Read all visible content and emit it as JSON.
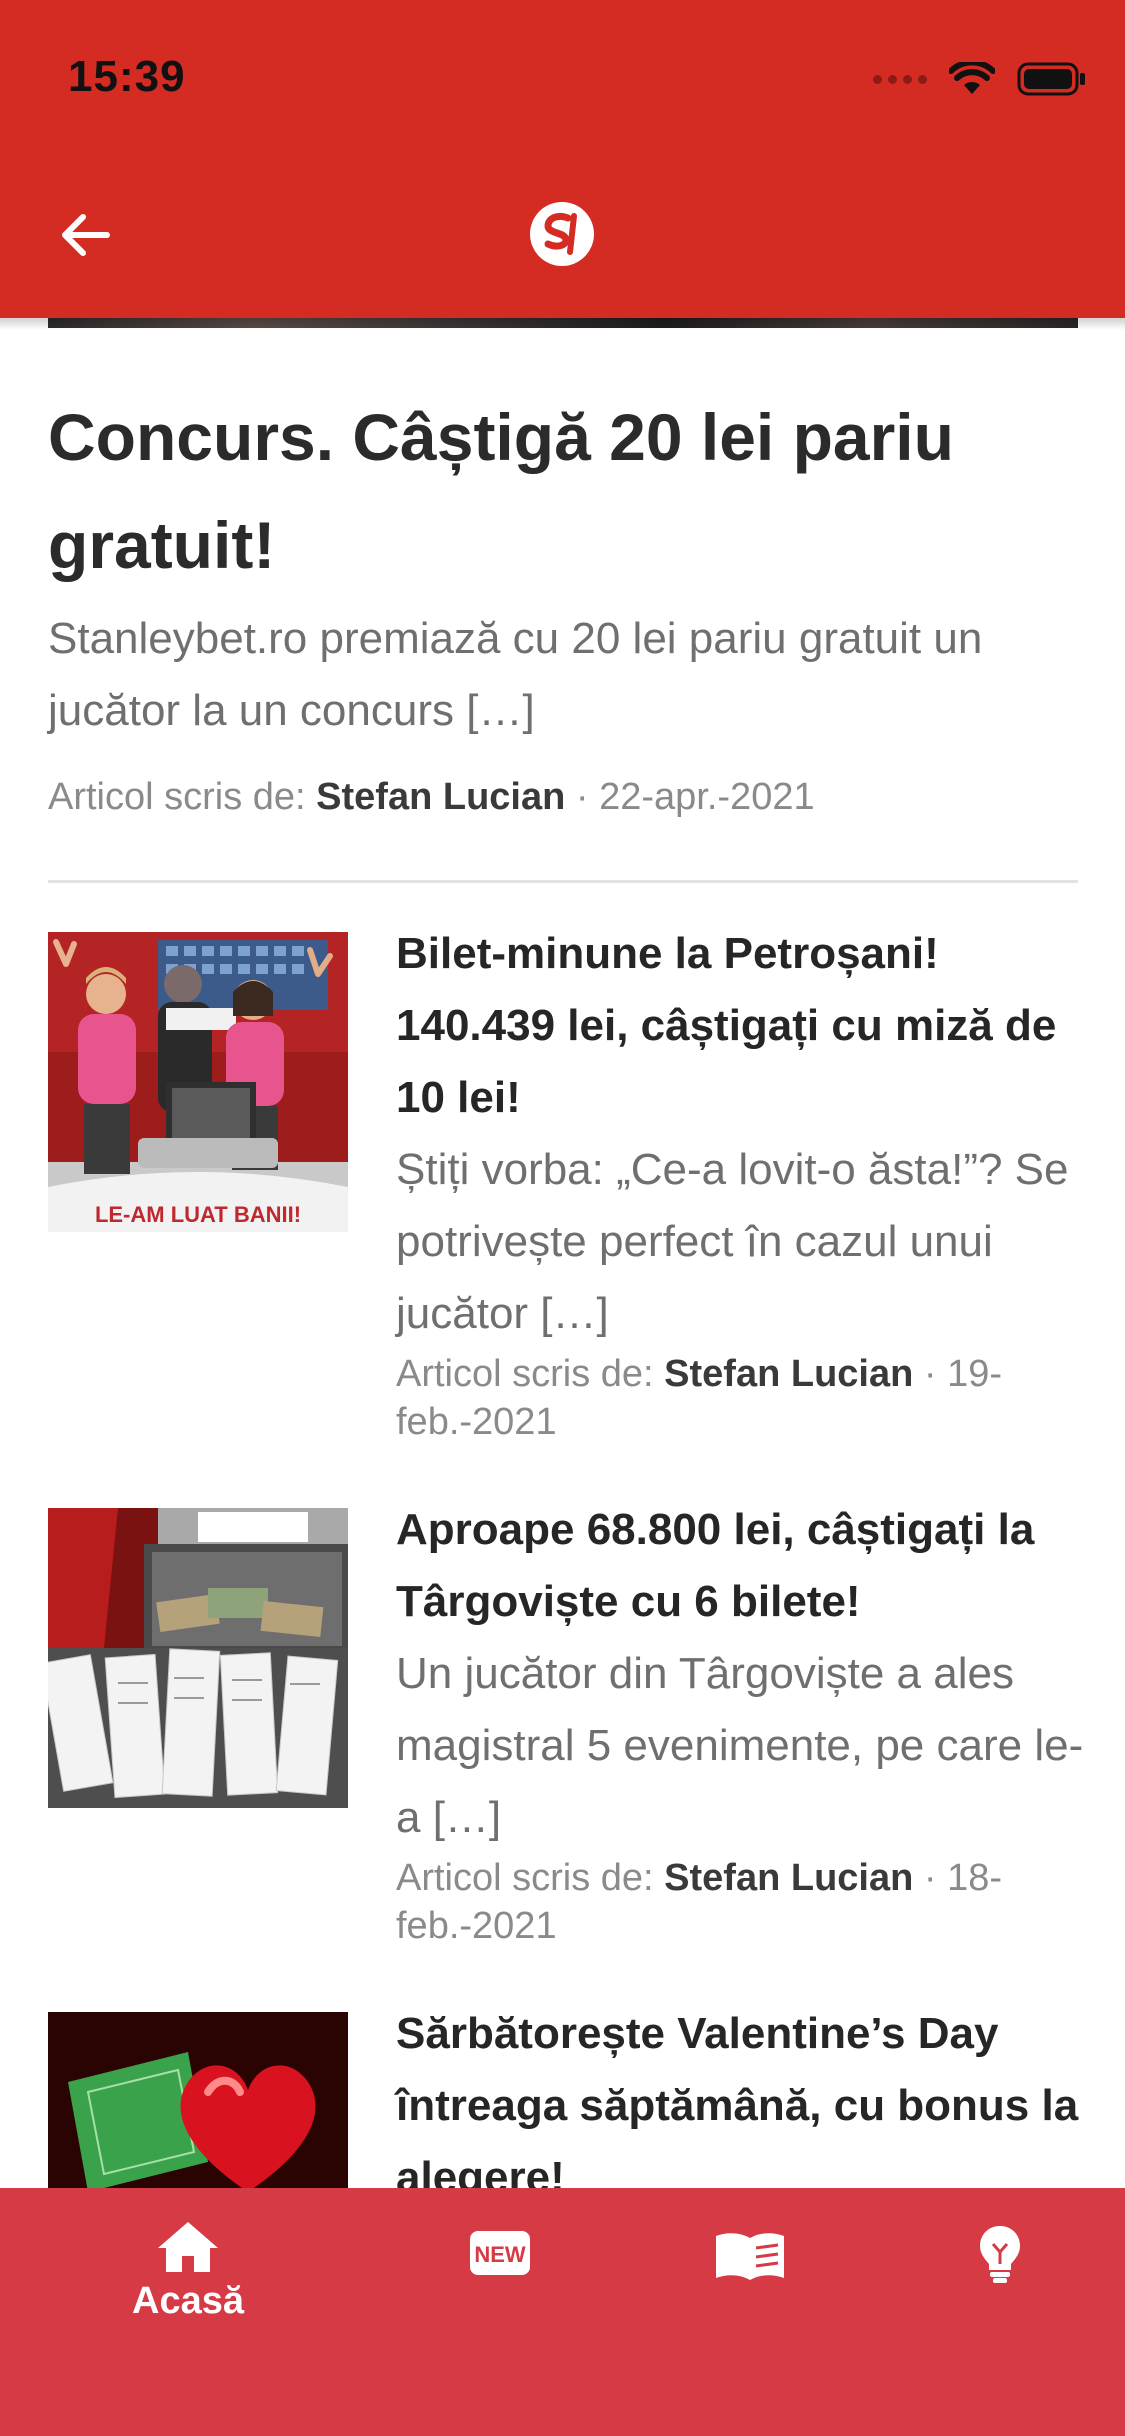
{
  "status_bar": {
    "time": "15:39"
  },
  "feature": {
    "title": "Concurs. Câștigă 20 lei pariu gratuit!",
    "excerpt": "Stanleybet.ro premiază cu 20 lei pariu gratuit un jucător la un concurs […]",
    "meta_prefix": "Articol scris de: ",
    "author": "Stefan Lucian",
    "date": " · 22-apr.-2021"
  },
  "articles": [
    {
      "title": "Bilet-minune la Petroșani! 140.439 lei, câștigați cu miză de 10 lei!",
      "excerpt": "Știți vorba: „Ce-a lovit-o ăsta!”? Se potrivește perfect în cazul unui jucător […]",
      "meta_prefix": "Articol scris de: ",
      "author": "Stefan Lucian",
      "date": " · 19-feb.-2021",
      "thumb_banner": "LE-AM LUAT BANII!"
    },
    {
      "title": "Aproape 68.800 lei, câștigați la Târgoviște cu 6 bilete!",
      "excerpt": "Un jucător din Târgoviște a ales magistral 5 evenimente, pe care le-a […]",
      "meta_prefix": "Articol scris de: ",
      "author": "Stefan Lucian",
      "date": " · 18-feb.-2021"
    },
    {
      "title": "Sărbătorește Valentine’s Day întreaga săptămână, cu bonus la alegere!",
      "excerpt": "",
      "meta_prefix": "",
      "author": "",
      "date": ""
    }
  ],
  "tabbar": {
    "home_label": "Acasă",
    "new_icon_text": "NEW",
    "items": [
      "home-icon",
      "new-icon",
      "book-icon",
      "lightbulb-icon"
    ]
  },
  "colors": {
    "header": "#d42b22",
    "tabbar": "#d63a45"
  }
}
